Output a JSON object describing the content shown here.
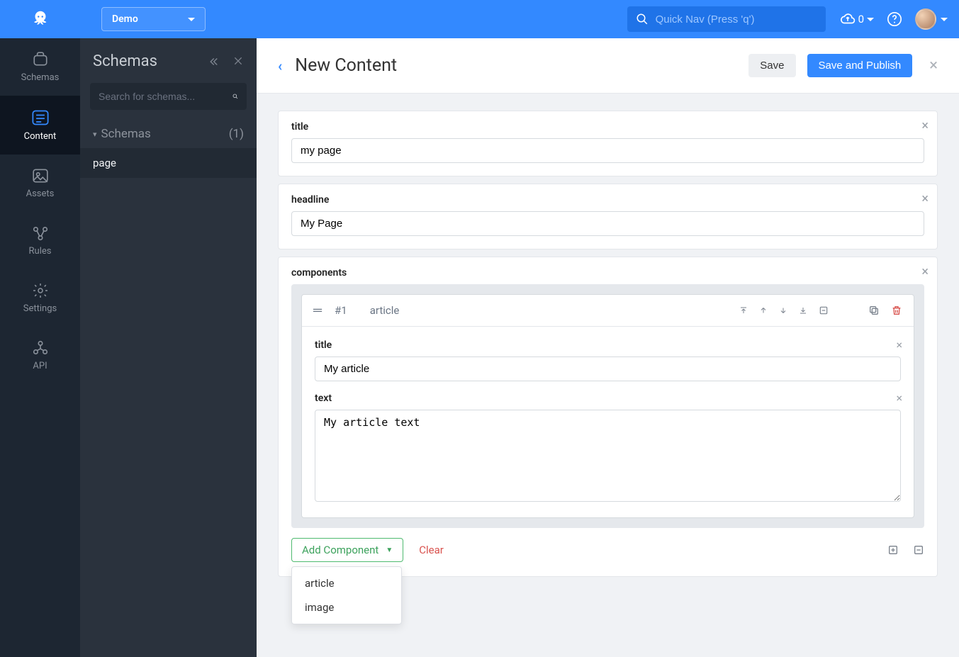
{
  "topbar": {
    "app_dropdown_label": "Demo",
    "search_placeholder": "Quick Nav (Press 'q')",
    "upload_count": "0"
  },
  "leftnav": {
    "items": [
      {
        "label": "Schemas",
        "icon": "schemas-icon"
      },
      {
        "label": "Content",
        "icon": "content-icon"
      },
      {
        "label": "Assets",
        "icon": "assets-icon"
      },
      {
        "label": "Rules",
        "icon": "rules-icon"
      },
      {
        "label": "Settings",
        "icon": "settings-icon"
      },
      {
        "label": "API",
        "icon": "api-icon"
      }
    ],
    "active_index": 1
  },
  "secondary": {
    "title": "Schemas",
    "search_placeholder": "Search for schemas...",
    "group_label": "Schemas",
    "group_count": "(1)",
    "items": [
      {
        "label": "page"
      }
    ]
  },
  "main": {
    "title": "New Content",
    "save_label": "Save",
    "save_publish_label": "Save and Publish",
    "fields": {
      "title_label": "title",
      "title_value": "my page",
      "headline_label": "headline",
      "headline_value": "My Page",
      "components_label": "components",
      "clear_label": "Clear",
      "add_component_label": "Add Component"
    },
    "component": {
      "index": "#1",
      "type": "article",
      "title_label": "title",
      "title_value": "My article",
      "text_label": "text",
      "text_value": "My article text"
    },
    "add_component_options": [
      {
        "label": "article"
      },
      {
        "label": "image"
      }
    ]
  }
}
